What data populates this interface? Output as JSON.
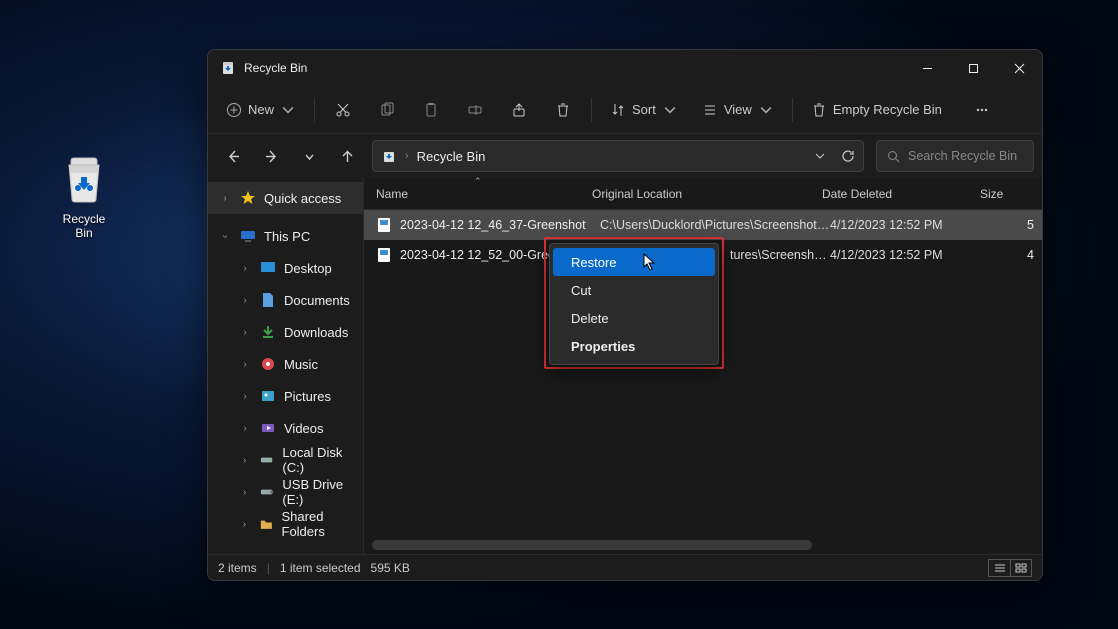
{
  "desktop": {
    "recycle_bin_label": "Recycle Bin"
  },
  "window": {
    "title": "Recycle Bin",
    "toolbar": {
      "new": "New",
      "sort": "Sort",
      "view": "View",
      "empty": "Empty Recycle Bin"
    },
    "breadcrumb": {
      "current": "Recycle Bin"
    },
    "search_placeholder": "Search Recycle Bin",
    "columns": {
      "name": "Name",
      "original_location": "Original Location",
      "date_deleted": "Date Deleted",
      "size": "Size"
    },
    "files": [
      {
        "name": "2023-04-12 12_46_37-Greenshot",
        "original_location": "C:\\Users\\Ducklord\\Pictures\\Screenshots\\...",
        "date_deleted": "4/12/2023 12:52 PM",
        "size": "5",
        "selected": true
      },
      {
        "name": "2023-04-12 12_52_00-Greenshot",
        "original_location_tail": "tures\\Screenshots\\...",
        "date_deleted": "4/12/2023 12:52 PM",
        "size": "4",
        "selected": false
      }
    ],
    "context_menu": {
      "restore": "Restore",
      "cut": "Cut",
      "delete": "Delete",
      "properties": "Properties"
    },
    "sidebar": {
      "quick_access": "Quick access",
      "this_pc": "This PC",
      "items": [
        {
          "label": "Desktop"
        },
        {
          "label": "Documents"
        },
        {
          "label": "Downloads"
        },
        {
          "label": "Music"
        },
        {
          "label": "Pictures"
        },
        {
          "label": "Videos"
        },
        {
          "label": "Local Disk (C:)"
        },
        {
          "label": "USB Drive (E:)"
        },
        {
          "label": "Shared Folders"
        }
      ]
    },
    "status": {
      "item_count": "2 items",
      "selection": "1 item selected",
      "selection_size": "595 KB"
    }
  }
}
